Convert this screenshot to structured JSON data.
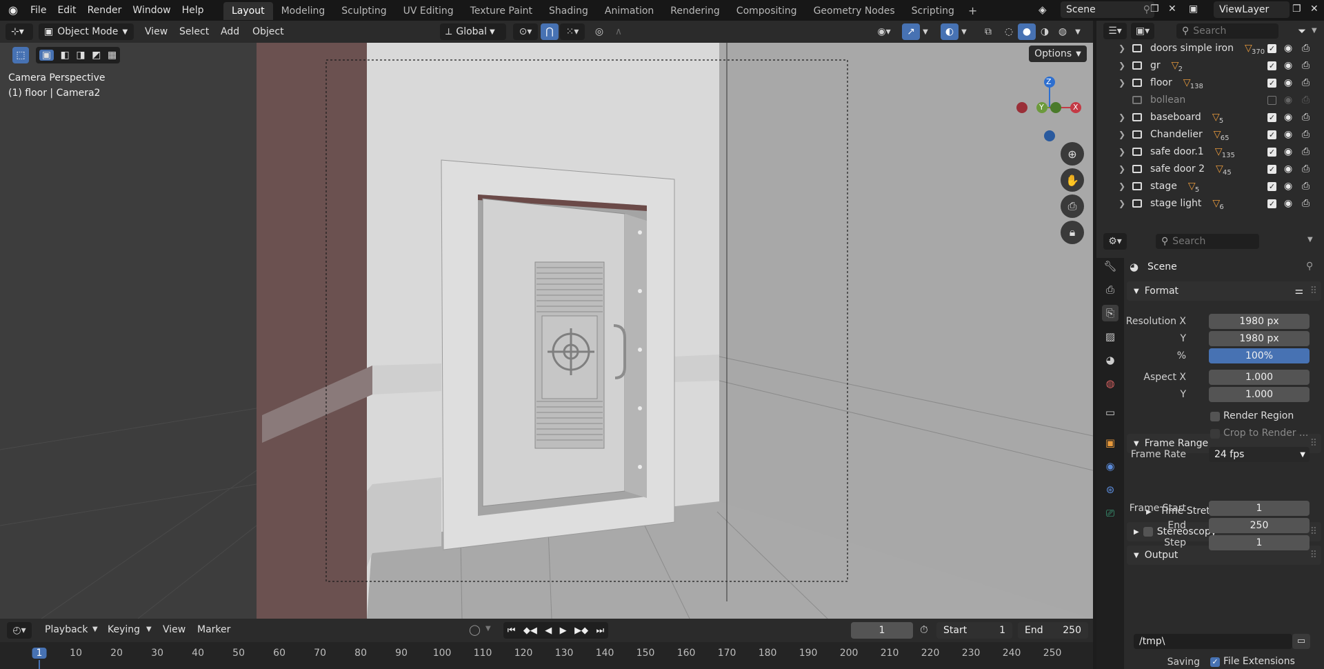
{
  "topbar": {
    "menus": [
      "File",
      "Edit",
      "Render",
      "Window",
      "Help"
    ],
    "workspaces": [
      "Layout",
      "Modeling",
      "Sculpting",
      "UV Editing",
      "Texture Paint",
      "Shading",
      "Animation",
      "Rendering",
      "Compositing",
      "Geometry Nodes",
      "Scripting"
    ],
    "active_workspace": "Layout",
    "add_tab": "+",
    "scene": "Scene",
    "view_layer": "ViewLayer"
  },
  "viewport_header": {
    "mode": "Object Mode",
    "menus": [
      "View",
      "Select",
      "Add",
      "Object"
    ],
    "orientation": "Global",
    "options": "Options"
  },
  "viewport": {
    "camera_label": "Camera Perspective",
    "object_label": "(1) floor | Camera2",
    "gizmo": {
      "z": "Z",
      "y": "Y",
      "x": "X"
    }
  },
  "outliner": {
    "search_placeholder": "Search",
    "rows": [
      {
        "name": "doors simple iron",
        "count": "370",
        "enabled": true
      },
      {
        "name": "gr",
        "count": "2",
        "enabled": true
      },
      {
        "name": "floor",
        "count": "138",
        "enabled": true
      },
      {
        "name": "bollean",
        "count": "",
        "enabled": false
      },
      {
        "name": "baseboard",
        "count": "5",
        "enabled": true
      },
      {
        "name": "Chandelier",
        "count": "65",
        "enabled": true
      },
      {
        "name": "safe door.1",
        "count": "135",
        "enabled": true
      },
      {
        "name": "safe door 2",
        "count": "45",
        "enabled": true
      },
      {
        "name": "stage",
        "count": "5",
        "enabled": true
      },
      {
        "name": "stage light",
        "count": "6",
        "enabled": true
      }
    ]
  },
  "properties": {
    "search_placeholder": "Search",
    "context": "Scene",
    "format": {
      "title": "Format",
      "resolution_x_label": "Resolution X",
      "resolution_x": "1980 px",
      "resolution_y_label": "Y",
      "resolution_y": "1980 px",
      "percent_label": "%",
      "percent": "100%",
      "aspect_x_label": "Aspect X",
      "aspect_x": "1.000",
      "aspect_y_label": "Y",
      "aspect_y": "1.000",
      "render_region": "Render Region",
      "crop_to_render": "Crop to Render ...",
      "frame_rate_label": "Frame Rate",
      "frame_rate": "24 fps"
    },
    "frame_range": {
      "title": "Frame Range",
      "start_label": "Frame Start",
      "start": "1",
      "end_label": "End",
      "end": "250",
      "step_label": "Step",
      "step": "1"
    },
    "time_stretching": "Time Stretching",
    "stereoscopy": "Stereoscopy",
    "output": {
      "title": "Output",
      "path": "/tmp\\",
      "saving_label": "Saving",
      "file_extensions": "File Extensions"
    }
  },
  "timeline": {
    "menus": [
      "Playback",
      "Keying",
      "View",
      "Marker"
    ],
    "current_frame": "1",
    "start_label": "Start",
    "start": "1",
    "end_label": "End",
    "end": "250",
    "ticks": [
      "1",
      "10",
      "20",
      "30",
      "40",
      "50",
      "60",
      "70",
      "80",
      "90",
      "100",
      "110",
      "120",
      "130",
      "140",
      "150",
      "160",
      "170",
      "180",
      "190",
      "200",
      "210",
      "220",
      "230",
      "240",
      "250"
    ]
  },
  "colors": {
    "accent": "#4772b3",
    "object_orange": "#e89a3c"
  }
}
